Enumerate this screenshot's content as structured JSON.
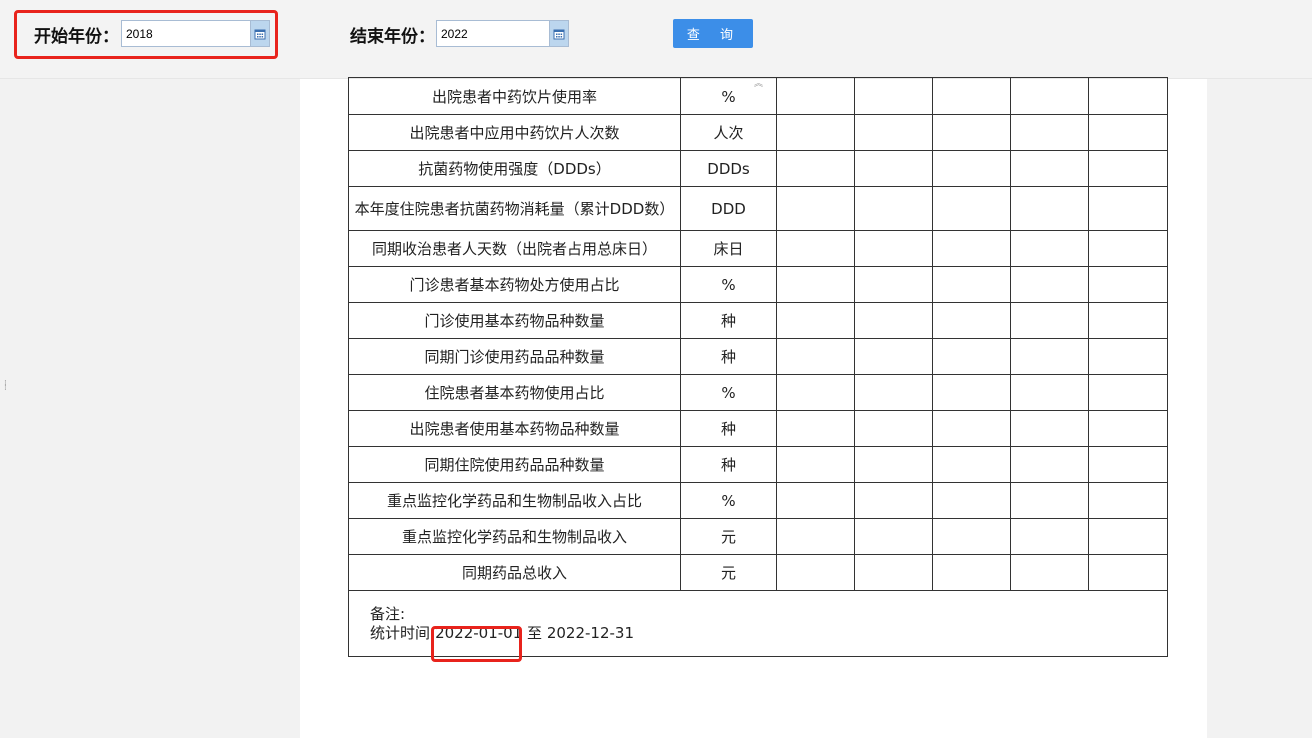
{
  "filters": {
    "start_label": "开始年份：",
    "start_value": "2018",
    "end_label": "结束年份：",
    "end_value": "2022",
    "query_button": "查 询"
  },
  "table": {
    "rows": [
      {
        "name": "出院患者中药饮片使用率",
        "unit": "%"
      },
      {
        "name": "出院患者中应用中药饮片人次数",
        "unit": "人次"
      },
      {
        "name": "抗菌药物使用强度（DDDs）",
        "unit": "DDDs"
      },
      {
        "name": "本年度住院患者抗菌药物消耗量（累计DDD数）",
        "unit": "DDD"
      },
      {
        "name": "同期收治患者人天数（出院者占用总床日）",
        "unit": "床日"
      },
      {
        "name": "门诊患者基本药物处方使用占比",
        "unit": "%"
      },
      {
        "name": "门诊使用基本药物品种数量",
        "unit": "种"
      },
      {
        "name": "同期门诊使用药品品种数量",
        "unit": "种"
      },
      {
        "name": "住院患者基本药物使用占比",
        "unit": "%"
      },
      {
        "name": "出院患者使用基本药物品种数量",
        "unit": "种"
      },
      {
        "name": "同期住院使用药品品种数量",
        "unit": "种"
      },
      {
        "name": "重点监控化学药品和生物制品收入占比",
        "unit": "%"
      },
      {
        "name": "重点监控化学药品和生物制品收入",
        "unit": "元"
      },
      {
        "name": "同期药品总收入",
        "unit": "元"
      }
    ],
    "note_label": "备注:",
    "time_prefix": "统计时间:",
    "time_start": "2022-01-01",
    "time_sep": "至",
    "time_end": "2022-12-31"
  },
  "icons": {
    "calendar": "calendar-icon",
    "collapse": "chevron-up-icon",
    "grip": "drag-grip-icon"
  },
  "colors": {
    "accent": "#3c8ee8",
    "highlight": "#e8231c",
    "calendar_button": "#bcd6ee"
  }
}
